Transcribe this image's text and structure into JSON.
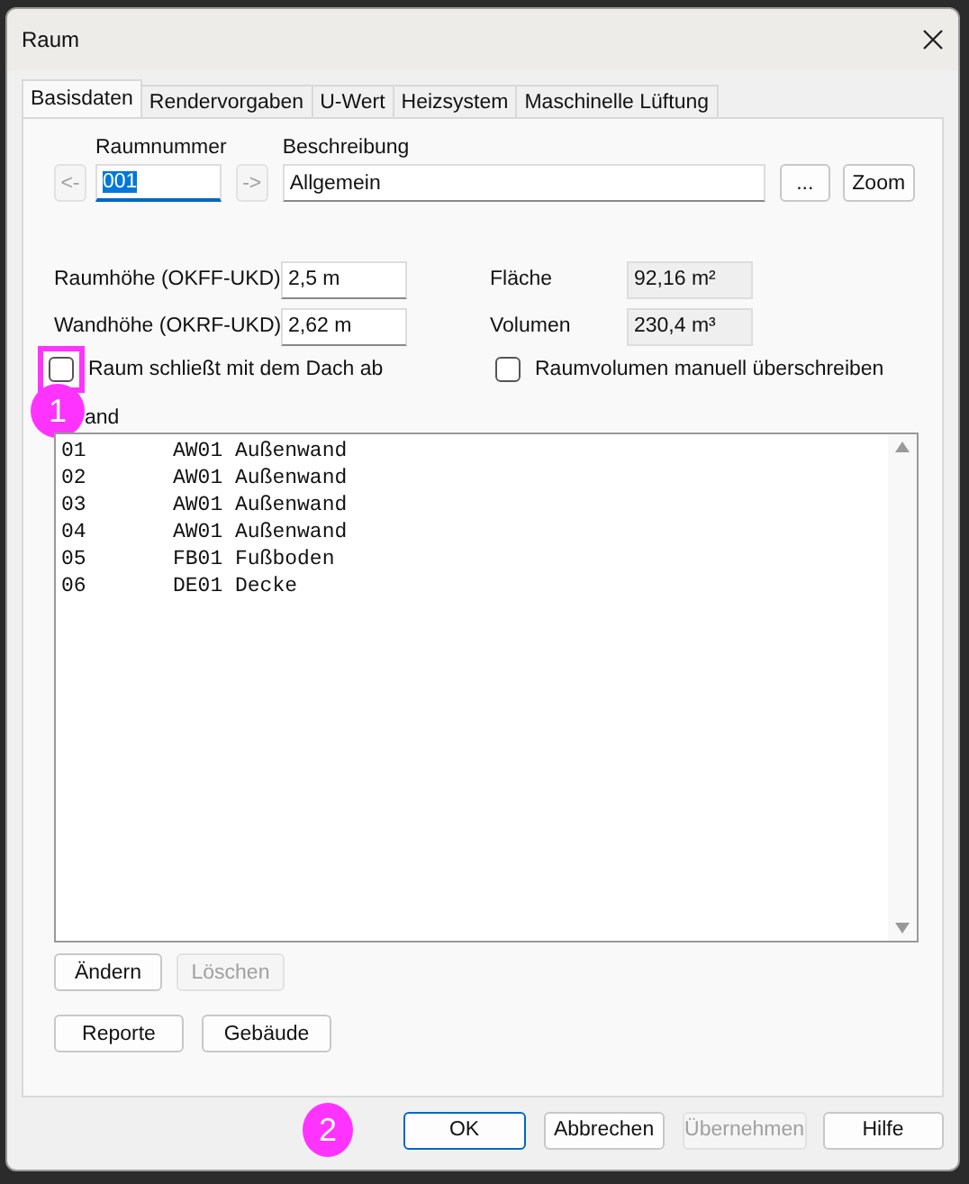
{
  "window": {
    "title": "Raum"
  },
  "tabs": [
    {
      "label": "Basisdaten",
      "selected": true
    },
    {
      "label": "Rendervorgaben",
      "selected": false
    },
    {
      "label": "U-Wert",
      "selected": false
    },
    {
      "label": "Heizsystem",
      "selected": false
    },
    {
      "label": "Maschinelle Lüftung",
      "selected": false
    }
  ],
  "room": {
    "prev": "<-",
    "next": "->",
    "number_label": "Raumnummer",
    "number": "001",
    "description_label": "Beschreibung",
    "description": "Allgemein",
    "browse": "...",
    "zoom": "Zoom"
  },
  "fields": [
    {
      "label": "Raumhöhe (OKFF-UKD)",
      "value": "2,5 m",
      "readonly": false,
      "side_label": "Fläche",
      "side_value": "92,16 m²"
    },
    {
      "label": "Wandhöhe (OKRF-UKD)",
      "value": "2,62 m",
      "readonly": false,
      "side_label": "Volumen",
      "side_value": "230,4 m³"
    }
  ],
  "checkboxes": [
    {
      "label": "Raum schließt mit dem Dach ab",
      "checked": false,
      "highlighted": true
    },
    {
      "label": "Raumvolumen manuell überschreiben",
      "checked": false,
      "highlighted": false
    }
  ],
  "walls": {
    "label": "and",
    "rows": [
      {
        "number": "01",
        "name": "AW01 Außenwand"
      },
      {
        "number": "02",
        "name": "AW01 Außenwand"
      },
      {
        "number": "03",
        "name": "AW01 Außenwand"
      },
      {
        "number": "04",
        "name": "AW01 Außenwand"
      },
      {
        "number": "05",
        "name": "FB01 Fußboden"
      },
      {
        "number": "06",
        "name": "DE01 Decke"
      }
    ]
  },
  "list_buttons": [
    {
      "label": "Ändern",
      "disabled": false
    },
    {
      "label": "Löschen",
      "disabled": true
    }
  ],
  "panel_buttons": [
    {
      "label": "Reporte",
      "disabled": false
    },
    {
      "label": "Gebäude",
      "disabled": false
    }
  ],
  "dialog_buttons": [
    {
      "label": "OK",
      "disabled": false,
      "default": true
    },
    {
      "label": "Abbrechen",
      "disabled": false,
      "default": false
    },
    {
      "label": "Übernehmen",
      "disabled": true,
      "default": false
    },
    {
      "label": "Hilfe",
      "disabled": false,
      "default": false
    }
  ],
  "annotations": [
    {
      "label": "1",
      "color": "#ff33ff"
    },
    {
      "label": "2",
      "color": "#ff33ff"
    }
  ]
}
